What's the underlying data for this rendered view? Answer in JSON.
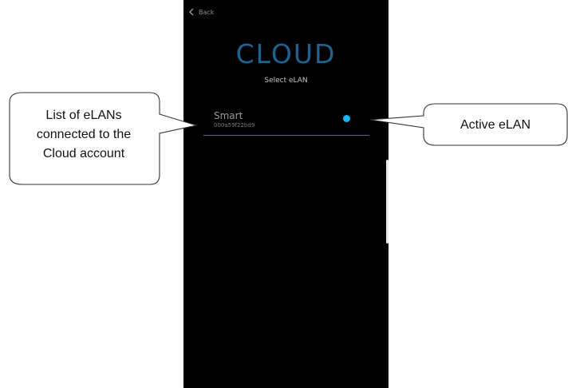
{
  "screen": {
    "back_label": "Back",
    "title": "CLOUD",
    "subtitle": "Select eLAN",
    "elan_list": [
      {
        "name": "Smart",
        "id": "000a59f22bd9",
        "active": true
      }
    ]
  },
  "annotations": {
    "left_callout": {
      "line1": "List of eLANs",
      "line2": "connected to the",
      "line3": "Cloud account"
    },
    "right_callout": {
      "text": "Active eLAN"
    }
  },
  "colors": {
    "screen_background": "#000000",
    "title": "#1f6390",
    "active_indicator": "#19b4f2",
    "divider": "#3a6e94"
  }
}
